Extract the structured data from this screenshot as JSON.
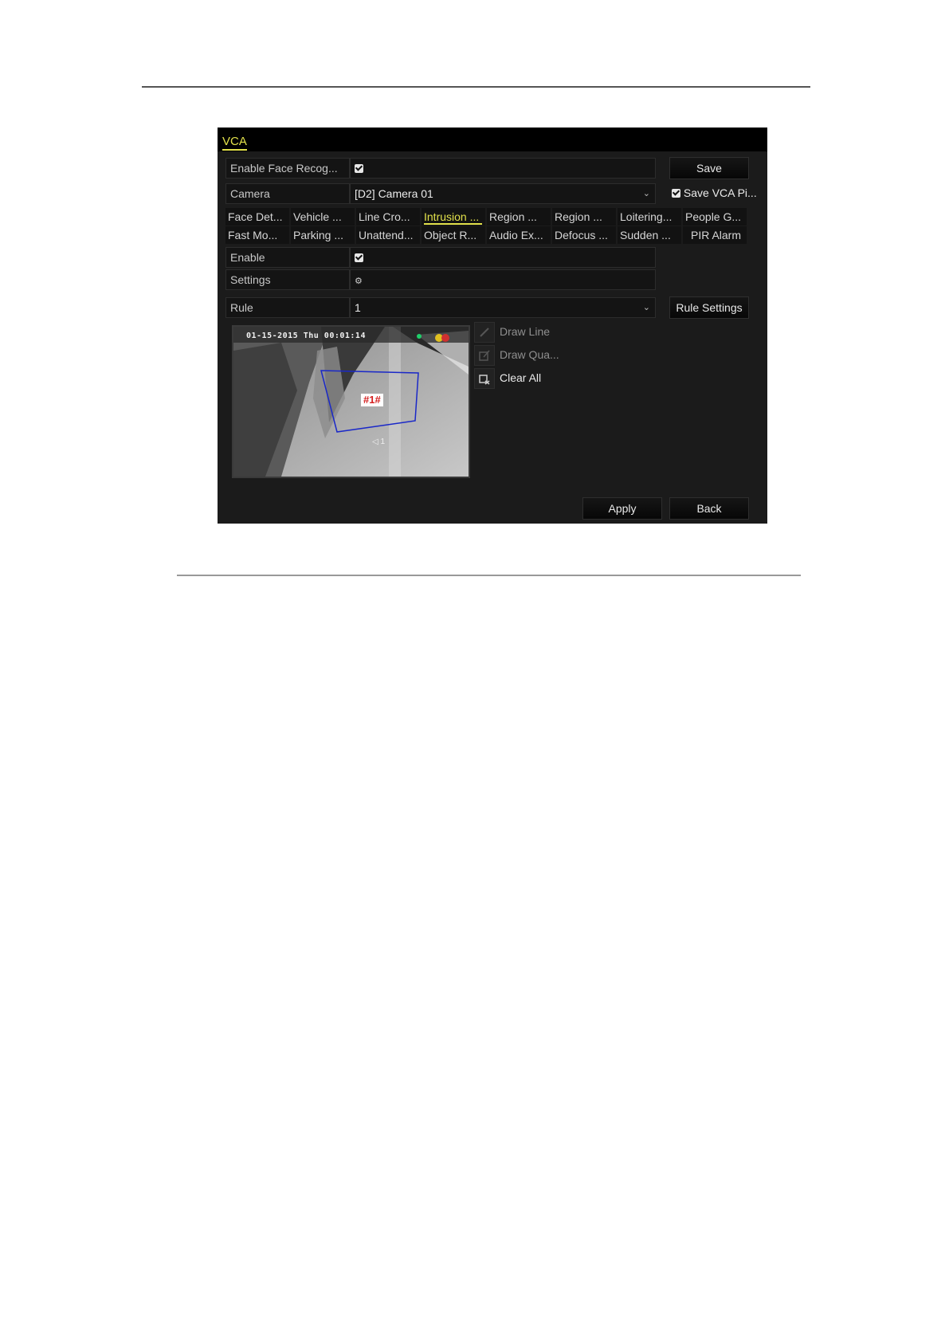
{
  "window": {
    "title": "VCA"
  },
  "form": {
    "enable_face_label": "Enable Face Recog...",
    "save_label": "Save",
    "camera_label": "Camera",
    "camera_value": "[D2] Camera 01",
    "save_pic_label": "Save VCA Pi...",
    "enable_label": "Enable",
    "settings_label": "Settings",
    "rule_label": "Rule",
    "rule_value": "1",
    "rule_settings_label": "Rule Settings"
  },
  "tabs": [
    "Face Det...",
    "Vehicle ...",
    "Line Cro...",
    "Intrusion ...",
    "Region ...",
    "Region ...",
    "Loitering...",
    "People G...",
    "Fast Mo...",
    "Parking ...",
    "Unattend...",
    "Object R...",
    "Audio Ex...",
    "Defocus ...",
    "Sudden ...",
    "PIR Alarm"
  ],
  "active_tab": "Intrusion ...",
  "preview": {
    "osd_date": "01-15-2015 Thu 00:01:14",
    "region_label": "#1#",
    "rule_marker": "◁ 1"
  },
  "tools": {
    "draw_line": "Draw Line",
    "draw_quad": "Draw Qua...",
    "clear_all": "Clear All"
  },
  "footer": {
    "apply": "Apply",
    "back": "Back"
  },
  "icons": {
    "checkbox": "checkmark-icon",
    "settings": "gear-icon",
    "dropdown": "chevron-down-icon",
    "draw_line": "pencil-icon",
    "draw_quad": "edit-icon",
    "clear_all": "clear-icon"
  },
  "colors": {
    "accent": "#e2e14b",
    "background": "#1b1b1b",
    "titlebar": "#000000",
    "region_outline": "#1a28c8"
  }
}
